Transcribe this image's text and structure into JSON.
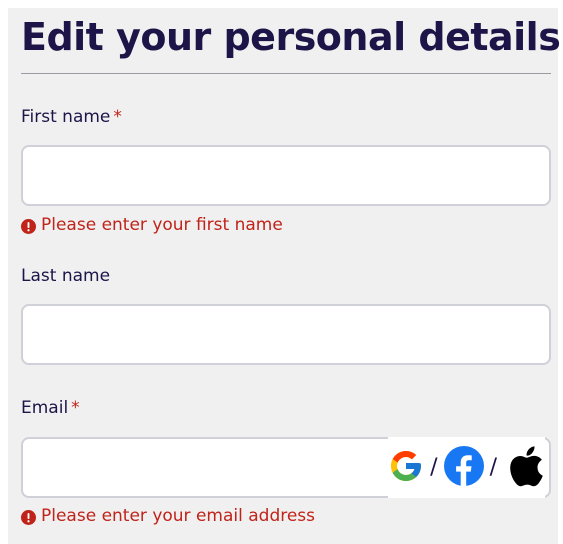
{
  "page": {
    "title": "Edit your personal details"
  },
  "form": {
    "first_name": {
      "label": "First name",
      "required_mark": "*",
      "value": "",
      "error": "Please enter your first name"
    },
    "last_name": {
      "label": "Last name",
      "value": ""
    },
    "email": {
      "label": "Email",
      "required_mark": "*",
      "value": "",
      "error": "Please enter your email address",
      "social_separator": "/",
      "social_icons": [
        "google-icon",
        "facebook-icon",
        "apple-icon"
      ]
    }
  },
  "colors": {
    "heading": "#1d1447",
    "error": "#c0231a",
    "panel_bg": "#f0f0f0",
    "input_border": "#cfd0d8",
    "facebook_blue": "#1877f2"
  }
}
